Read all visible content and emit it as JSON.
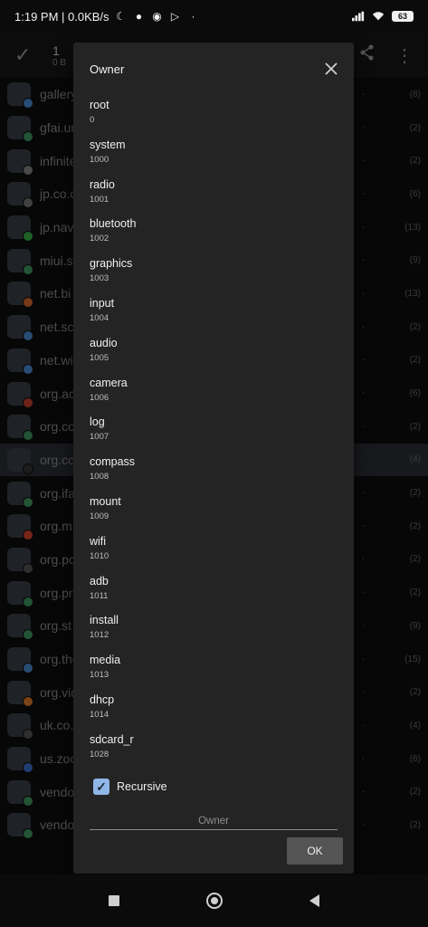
{
  "status_bar": {
    "time_speed": "1:19 PM | 0.0KB/s",
    "battery": "63",
    "icons": [
      "moon-icon",
      "circle-icon",
      "chat-icon",
      "play-icon",
      "dot-icon",
      "signal-icon",
      "wifi-icon",
      "battery-icon"
    ]
  },
  "appbar": {
    "selected_count": "1",
    "selected_size": "0 B"
  },
  "background_list": [
    {
      "name": "gallery.p",
      "count": "(8)",
      "badge": "#4a8ad4"
    },
    {
      "name": "gfai.unu",
      "count": "(2)",
      "badge": "#3e9a62"
    },
    {
      "name": "infinitec",
      "count": "(2)",
      "badge": "#888888"
    },
    {
      "name": "jp.co.ca",
      "count": "(6)",
      "badge": "#777777"
    },
    {
      "name": "jp.naver",
      "count": "(13)",
      "badge": "#38b34a"
    },
    {
      "name": "miui.sys",
      "count": "(9)",
      "badge": "#3e9a62"
    },
    {
      "name": "net.bi",
      "count": "(13)",
      "badge": "#d96a2a"
    },
    {
      "name": "net.sc",
      "count": "(2)",
      "badge": "#4a8ad4"
    },
    {
      "name": "net.wi",
      "count": "(2)",
      "badge": "#4a8ad4"
    },
    {
      "name": "org.ac",
      "count": "(6)",
      "badge": "#c8402e"
    },
    {
      "name": "org.co",
      "count": "(2)",
      "badge": "#3e9a62"
    },
    {
      "name": "org.co",
      "count": "(4)",
      "badge": "#333333"
    },
    {
      "name": "org.ifa",
      "count": "(2)",
      "badge": "#3e9a62"
    },
    {
      "name": "org.m",
      "count": "(2)",
      "badge": "#d9452a"
    },
    {
      "name": "org.pc",
      "count": "(2)",
      "badge": "#555555"
    },
    {
      "name": "org.pr",
      "count": "(2)",
      "badge": "#3e9a62"
    },
    {
      "name": "org.st",
      "count": "(9)",
      "badge": "#3e9a62"
    },
    {
      "name": "org.thou",
      "count": "(15)",
      "badge": "#4a8ad4"
    },
    {
      "name": "org.vide",
      "count": "(2)",
      "badge": "#e07a2a"
    },
    {
      "name": "uk.co.ni",
      "count": "(4)",
      "badge": "#555555"
    },
    {
      "name": "us.zoon",
      "count": "(6)",
      "badge": "#3a6fd0"
    },
    {
      "name": "vendor.c",
      "count": "(2)",
      "badge": "#3e9a62"
    },
    {
      "name": "vendor.",
      "count": "(2)",
      "badge": "#3e9a62"
    }
  ],
  "dialog": {
    "title": "Owner",
    "owners": [
      {
        "name": "root",
        "id": "0"
      },
      {
        "name": "system",
        "id": "1000"
      },
      {
        "name": "radio",
        "id": "1001"
      },
      {
        "name": "bluetooth",
        "id": "1002"
      },
      {
        "name": "graphics",
        "id": "1003"
      },
      {
        "name": "input",
        "id": "1004"
      },
      {
        "name": "audio",
        "id": "1005"
      },
      {
        "name": "camera",
        "id": "1006"
      },
      {
        "name": "log",
        "id": "1007"
      },
      {
        "name": "compass",
        "id": "1008"
      },
      {
        "name": "mount",
        "id": "1009"
      },
      {
        "name": "wifi",
        "id": "1010"
      },
      {
        "name": "adb",
        "id": "1011"
      },
      {
        "name": "install",
        "id": "1012"
      },
      {
        "name": "media",
        "id": "1013"
      },
      {
        "name": "dhcp",
        "id": "1014"
      },
      {
        "name": "sdcard_r",
        "id": "1028"
      }
    ],
    "recursive_label": "Recursive",
    "recursive_checked": true,
    "owner_placeholder": "Owner",
    "ok_label": "OK"
  },
  "colors": {
    "dialog_bg": "#242424",
    "accent_checkbox": "#8fb6e6",
    "ok_button": "#545454"
  }
}
